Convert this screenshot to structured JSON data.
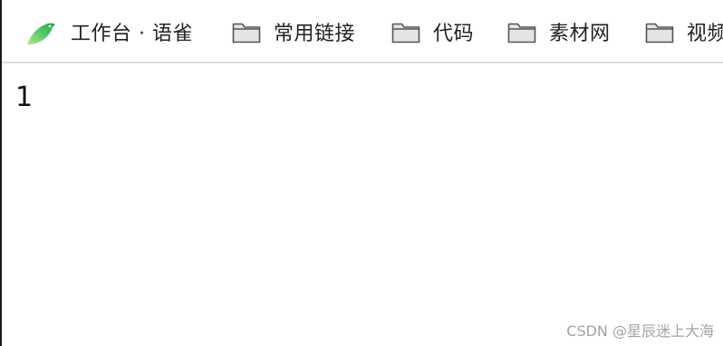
{
  "bookmarks": {
    "items": [
      {
        "label": "工作台 · 语雀",
        "icon": "yuque-bird-icon"
      },
      {
        "label": "常用链接",
        "icon": "folder-icon"
      },
      {
        "label": "代码",
        "icon": "folder-icon"
      },
      {
        "label": "素材网",
        "icon": "folder-icon"
      },
      {
        "label": "视频",
        "icon": "folder-icon"
      }
    ]
  },
  "page": {
    "text": "1"
  },
  "watermark": {
    "text": "CSDN @星辰迷上大海"
  },
  "colors": {
    "yuque_green_light": "#8fdc7a",
    "yuque_green_dark": "#2fb05a",
    "folder_fill": "#e4e4e4",
    "folder_stroke": "#555555",
    "divider": "#dcdcdc"
  }
}
